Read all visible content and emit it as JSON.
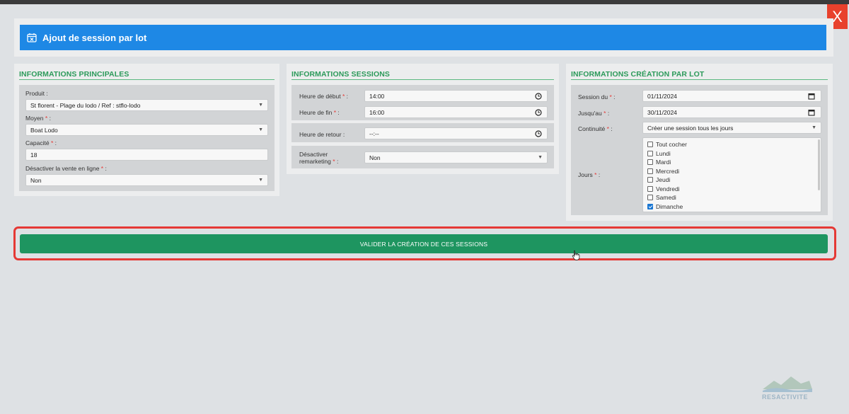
{
  "window": {
    "close_label": "X"
  },
  "header": {
    "title": "Ajout de session par lot",
    "icon": "calendar-x-icon"
  },
  "principales": {
    "title": "INFORMATIONS PRINCIPALES",
    "produit_label": "Produit :",
    "produit_value": "St florent - Plage du lodo / Ref : stflo-lodo",
    "moyen_label": "Moyen",
    "moyen_value": "Boat Lodo",
    "capacite_label": "Capacité",
    "capacite_value": "18",
    "desactiver_label": "Désactiver la vente en ligne",
    "desactiver_value": "Non"
  },
  "sessions": {
    "title": "INFORMATIONS SESSIONS",
    "debut_label": "Heure de début",
    "debut_value": "14:00",
    "fin_label": "Heure de fin",
    "fin_value": "16:00",
    "retour_label": "Heure de retour :",
    "retour_value": "--:--",
    "remarketing_label_1": "Désactiver",
    "remarketing_label_2": "remarketing",
    "remarketing_value": "Non"
  },
  "lot": {
    "title": "INFORMATIONS CRÉATION PAR LOT",
    "session_du_label": "Session du",
    "session_du_value": "01/11/2024",
    "jusquau_label": "Jusqu'au",
    "jusquau_value": "30/11/2024",
    "continuite_label": "Continuité",
    "continuite_value": "Créer une session tous les jours",
    "jours_label": "Jours",
    "days": [
      {
        "label": "Tout cocher",
        "checked": false
      },
      {
        "label": "Lundi",
        "checked": false
      },
      {
        "label": "Mardi",
        "checked": false
      },
      {
        "label": "Mercredi",
        "checked": false
      },
      {
        "label": "Jeudi",
        "checked": false
      },
      {
        "label": "Vendredi",
        "checked": false
      },
      {
        "label": "Samedi",
        "checked": false
      },
      {
        "label": "Dimanche",
        "checked": true
      }
    ]
  },
  "submit": {
    "label": "VALIDER LA CRÉATION DE CES SESSIONS"
  },
  "required_marker": "*",
  "colon": ":",
  "colors": {
    "accent_blue": "#1e88e5",
    "submit_green": "#1e9560",
    "title_green": "#2c9a5a",
    "highlight_red": "#e53935",
    "close_red": "#e8412c"
  },
  "logo": {
    "text": "RESACTIVITE"
  }
}
